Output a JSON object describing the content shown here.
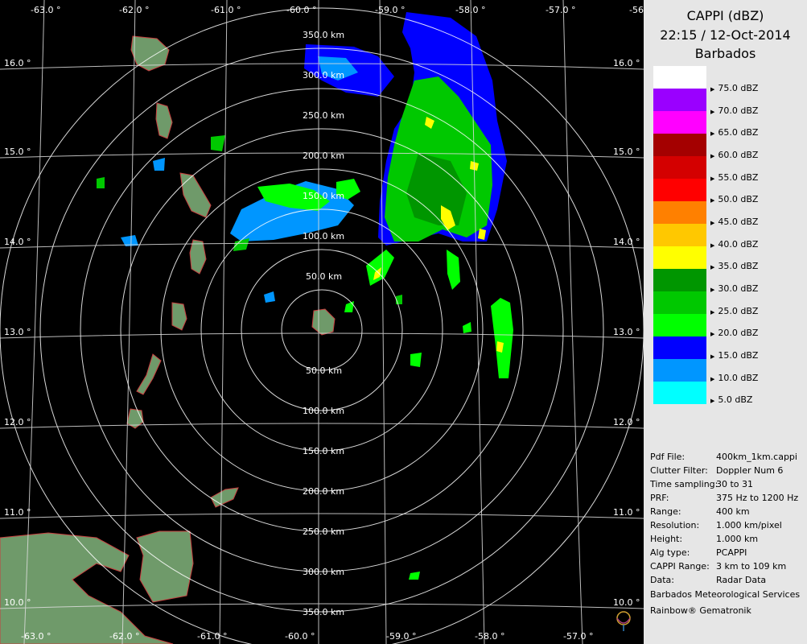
{
  "map": {
    "lon_labels": [
      "-63.0 °",
      "-62.0 °",
      "-61.0 °",
      "-60.0 °",
      "-59.0 °",
      "-58.0 °",
      "-57.0 °",
      "-56"
    ],
    "lat_labels": [
      "16.0 °",
      "15.0 °",
      "14.0 °",
      "13.0 °",
      "12.0 °",
      "11.0 °",
      "10.0 °"
    ],
    "range_labels_north": [
      "350.0 km",
      "300.0 km",
      "250.0 km",
      "200.0 km",
      "150.0 km",
      "100.0 km",
      "50.0 km"
    ],
    "range_labels_south": [
      "50.0 km",
      "100.0 km",
      "150.0 km",
      "200.0 km",
      "250.0 km",
      "300.0 km",
      "350.0 km"
    ]
  },
  "panel": {
    "product": "CAPPI (dBZ)",
    "datetime": "22:15 / 12-Oct-2014",
    "site": "Barbados",
    "legend": [
      {
        "label": "75.0 dBZ",
        "color": "#ffffff"
      },
      {
        "label": "70.0 dBZ",
        "color": "#9a00ff"
      },
      {
        "label": "65.0 dBZ",
        "color": "#ff00ff"
      },
      {
        "label": "60.0 dBZ",
        "color": "#a40000"
      },
      {
        "label": "55.0 dBZ",
        "color": "#d40000"
      },
      {
        "label": "50.0 dBZ",
        "color": "#ff0000"
      },
      {
        "label": "45.0 dBZ",
        "color": "#ff8000"
      },
      {
        "label": "40.0 dBZ",
        "color": "#ffc800"
      },
      {
        "label": "35.0 dBZ",
        "color": "#ffff00"
      },
      {
        "label": "30.0 dBZ",
        "color": "#009600"
      },
      {
        "label": "25.0 dBZ",
        "color": "#00c800"
      },
      {
        "label": "20.0 dBZ",
        "color": "#00ff00"
      },
      {
        "label": "15.0 dBZ",
        "color": "#0000ff"
      },
      {
        "label": "10.0 dBZ",
        "color": "#0096ff"
      },
      {
        "label": "5.0 dBZ",
        "color": "#00ffff"
      }
    ],
    "info": [
      {
        "key": "Pdf File:",
        "value": "400km_1km.cappi"
      },
      {
        "key": "Clutter Filter:",
        "value": "Doppler Num 6"
      },
      {
        "key": "Time sampling:",
        "value": "30 to 31"
      },
      {
        "key": "PRF:",
        "value": "375 Hz to 1200 Hz"
      },
      {
        "key": "Range:",
        "value": "400 km"
      },
      {
        "key": "Resolution:",
        "value": "1.000 km/pixel"
      },
      {
        "key": "Height:",
        "value": "1.000 km"
      },
      {
        "key": "Alg type:",
        "value": "PCAPPI"
      },
      {
        "key": "CAPPI Range:",
        "value": "3 km to 109 km"
      },
      {
        "key": "Data:",
        "value": "Radar Data"
      }
    ],
    "org": "Barbados Meteorological Services",
    "vendor": "Rainbow® Gematronik"
  }
}
